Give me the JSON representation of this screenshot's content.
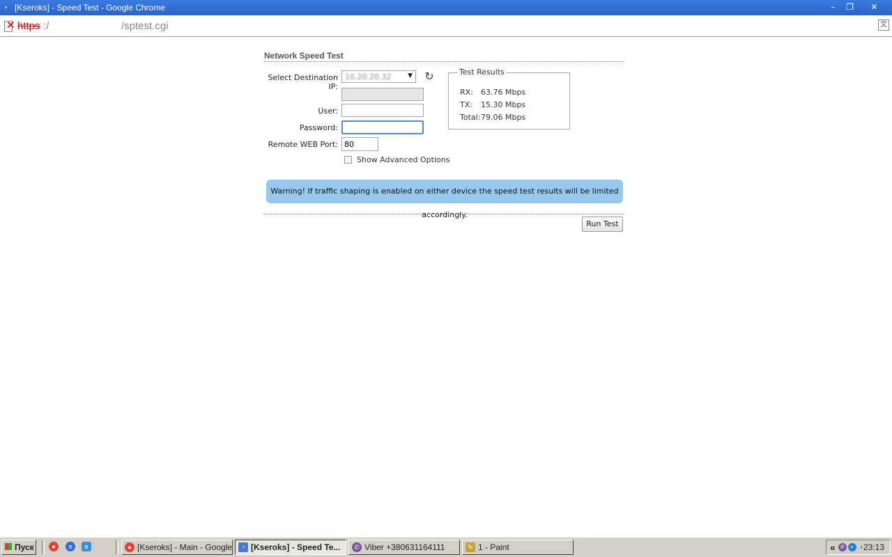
{
  "window": {
    "title": "[Kseroks] - Speed Test - Google Chrome",
    "minimize": "–",
    "restore": "❐",
    "close": "✕"
  },
  "address": {
    "protocol": "https",
    "separator": ":/",
    "path": "/sptest.cgi",
    "broken_icon": "✕"
  },
  "page": {
    "section_title": "Network Speed Test",
    "form": {
      "destination_label": "Select Destination IP:",
      "destination_value": "10.20.20.32",
      "user_label": "User:",
      "user_value": "",
      "password_label": "Password:",
      "password_value": "",
      "port_label": "Remote WEB Port:",
      "port_value": "80",
      "advanced_label": "Show Advanced Options",
      "advanced_checked": false
    },
    "results": {
      "legend": "Test Results",
      "rows": [
        {
          "label": "RX:",
          "value": "63.76 Mbps"
        },
        {
          "label": "TX:",
          "value": "15.30 Mbps"
        },
        {
          "label": "Total:",
          "value": "79.06 Mbps"
        }
      ]
    },
    "warning": "Warning! If traffic shaping is enabled on either device the speed test results will be limited accordingly.",
    "run_button": "Run Test"
  },
  "taskbar": {
    "start_label": "Пуск",
    "tasks": [
      {
        "label": "[Kseroks] - Main - Google...",
        "icon": "chrome-icon",
        "active": false
      },
      {
        "label": "[Kseroks] - Speed Te...",
        "icon": "rss-icon",
        "active": true
      },
      {
        "label": "Viber +380631164111",
        "icon": "viber-icon",
        "active": false
      },
      {
        "label": "1 - Paint",
        "icon": "paint-icon",
        "active": false
      }
    ],
    "tray_chevron": "«",
    "clock": "23:13"
  },
  "colors": {
    "titlebar": "#2a62c8",
    "warning_bg": "#97c8ee",
    "taskbar": "#d4d0c8"
  }
}
